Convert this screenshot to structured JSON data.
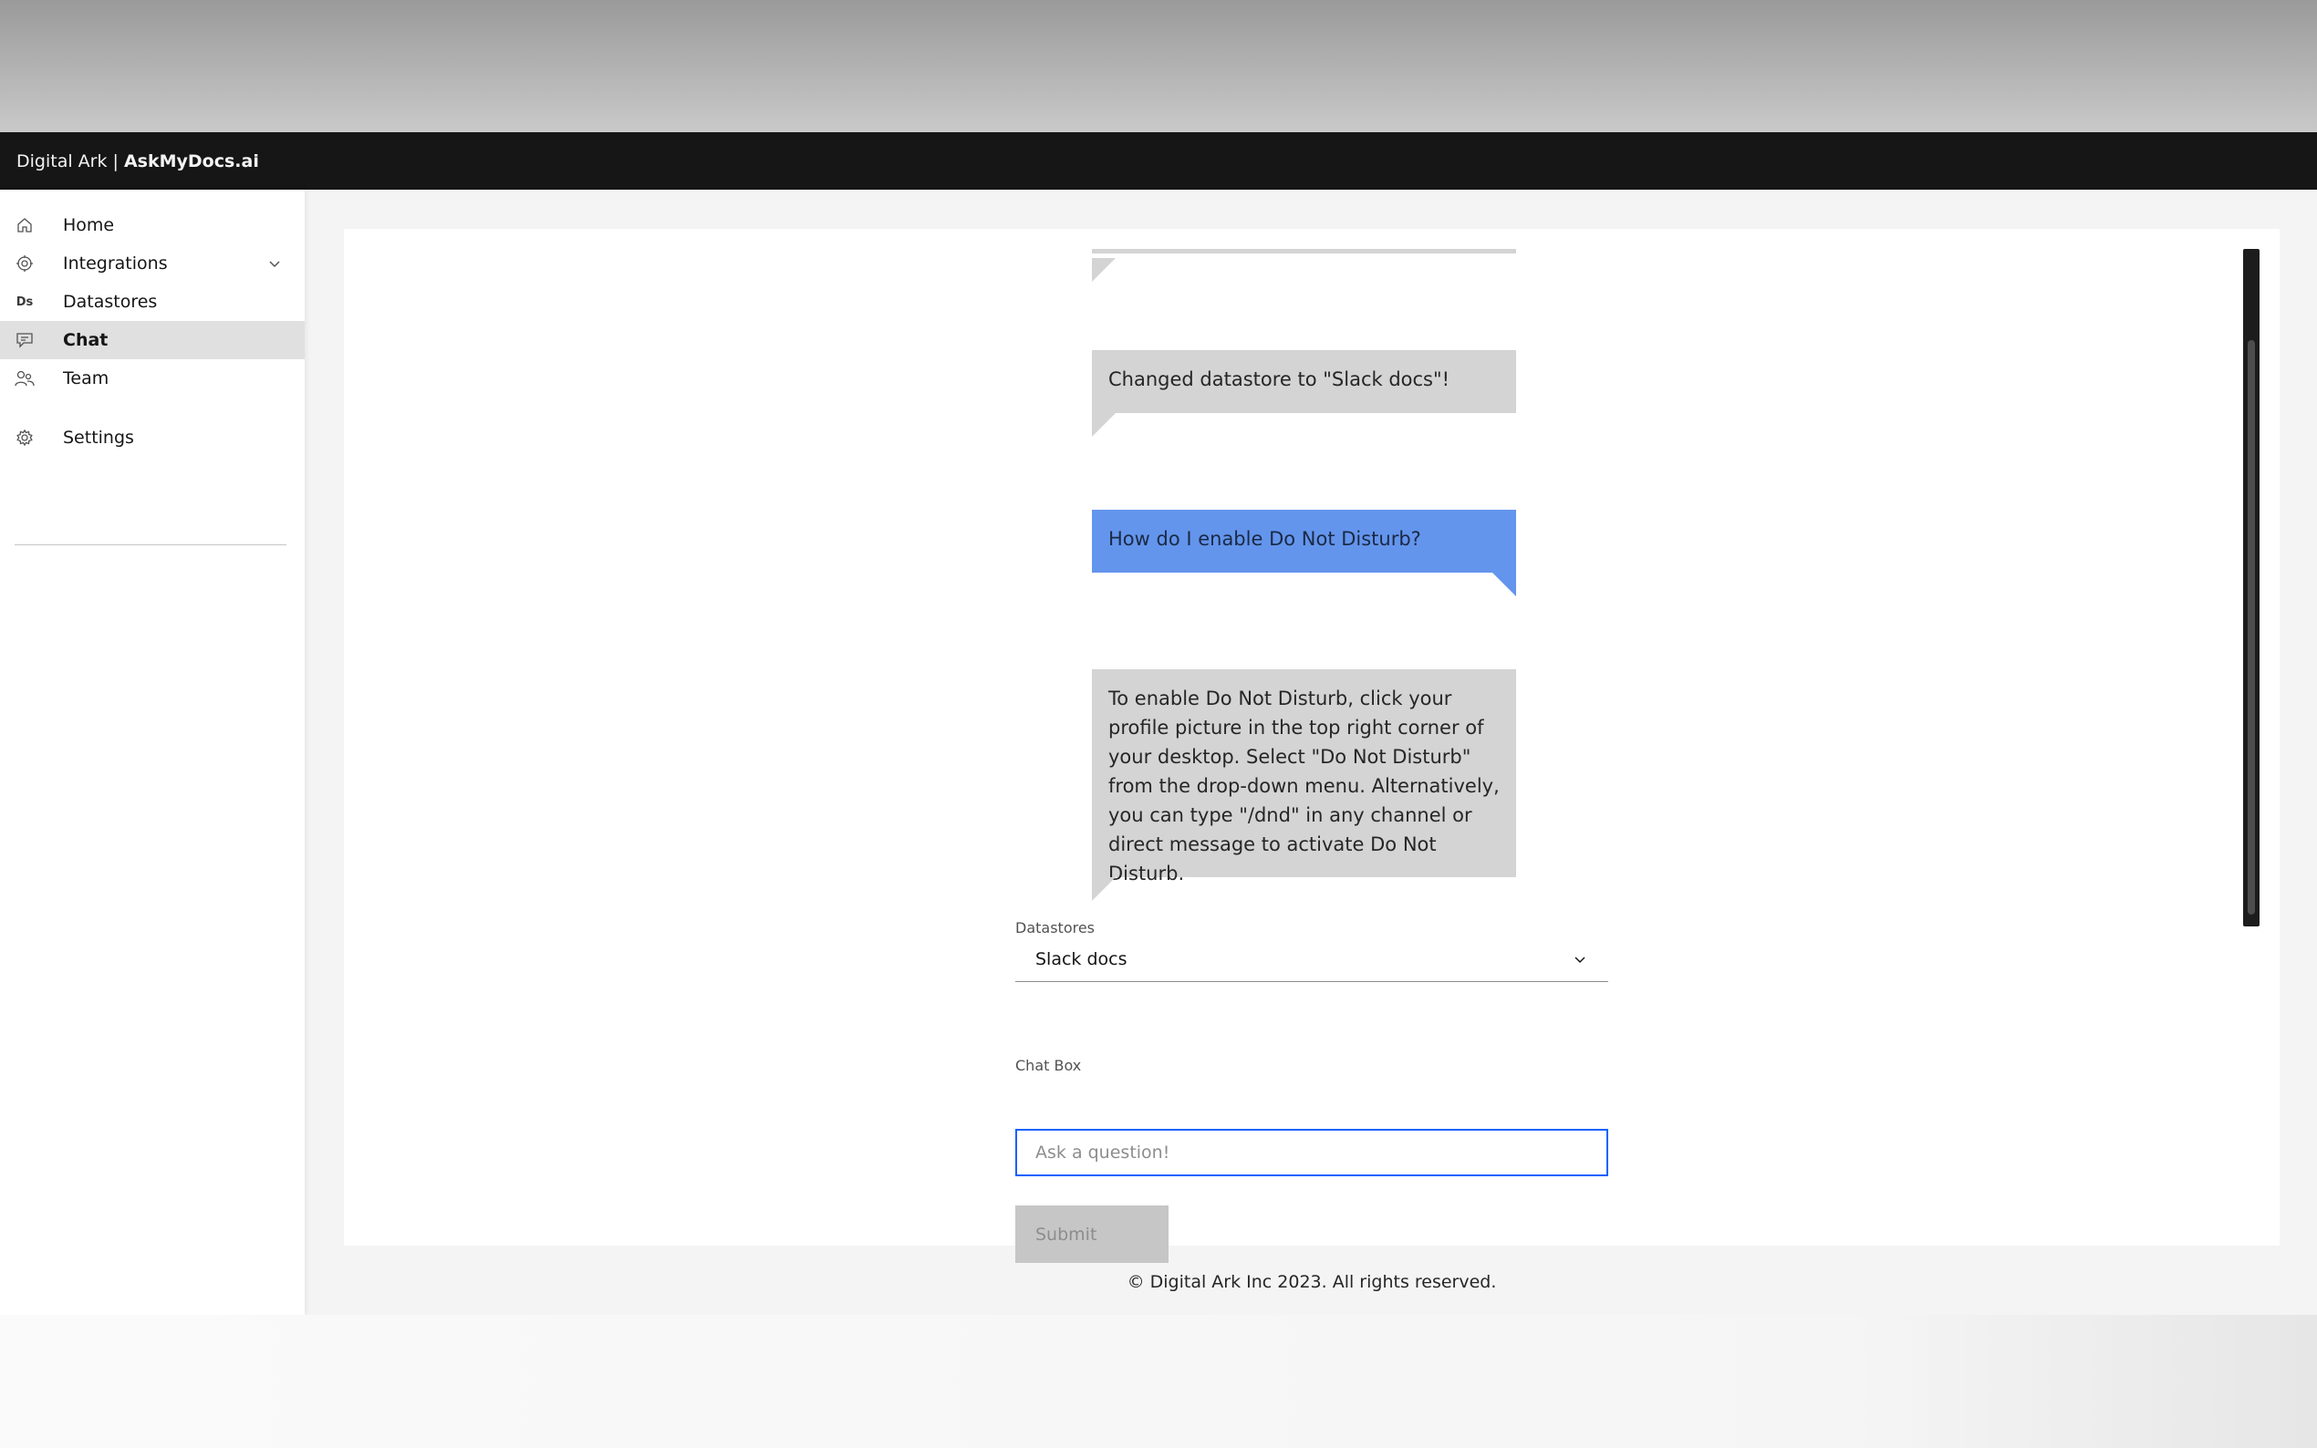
{
  "header": {
    "brand_prefix": "Digital Ark | ",
    "brand_name": "AskMyDocs.ai"
  },
  "sidebar": {
    "items": [
      {
        "label": "Home",
        "icon": "home-icon"
      },
      {
        "label": "Integrations",
        "icon": "gear-network-icon",
        "expandable": true
      },
      {
        "label": "Datastores",
        "icon": "Ds"
      },
      {
        "label": "Chat",
        "icon": "chat-icon",
        "active": true
      },
      {
        "label": "Team",
        "icon": "team-icon"
      },
      {
        "label": "Settings",
        "icon": "gear-icon"
      }
    ]
  },
  "chat": {
    "messages": [
      {
        "role": "bot",
        "text": ""
      },
      {
        "role": "bot",
        "text": "Changed datastore to \"Slack docs\"!"
      },
      {
        "role": "user",
        "text": "How do I enable Do Not Disturb?"
      },
      {
        "role": "bot",
        "text": "To enable Do Not Disturb, click your profile picture in the top right corner of your desktop. Select \"Do Not Disturb\" from the drop-down menu. Alternatively, you can type \"/dnd\" in any channel or direct message to activate Do Not Disturb."
      }
    ]
  },
  "form": {
    "datastores_label": "Datastores",
    "datastores_value": "Slack docs",
    "chatbox_label": "Chat Box",
    "chatbox_placeholder": "Ask a question!",
    "submit_label": "Submit"
  },
  "footer": {
    "text": "© Digital Ark Inc 2023. All rights reserved."
  },
  "colors": {
    "header_bg": "#161616",
    "user_bubble": "#6495ed",
    "bot_bubble": "#d4d4d4",
    "focus_border": "#0f62fe"
  }
}
